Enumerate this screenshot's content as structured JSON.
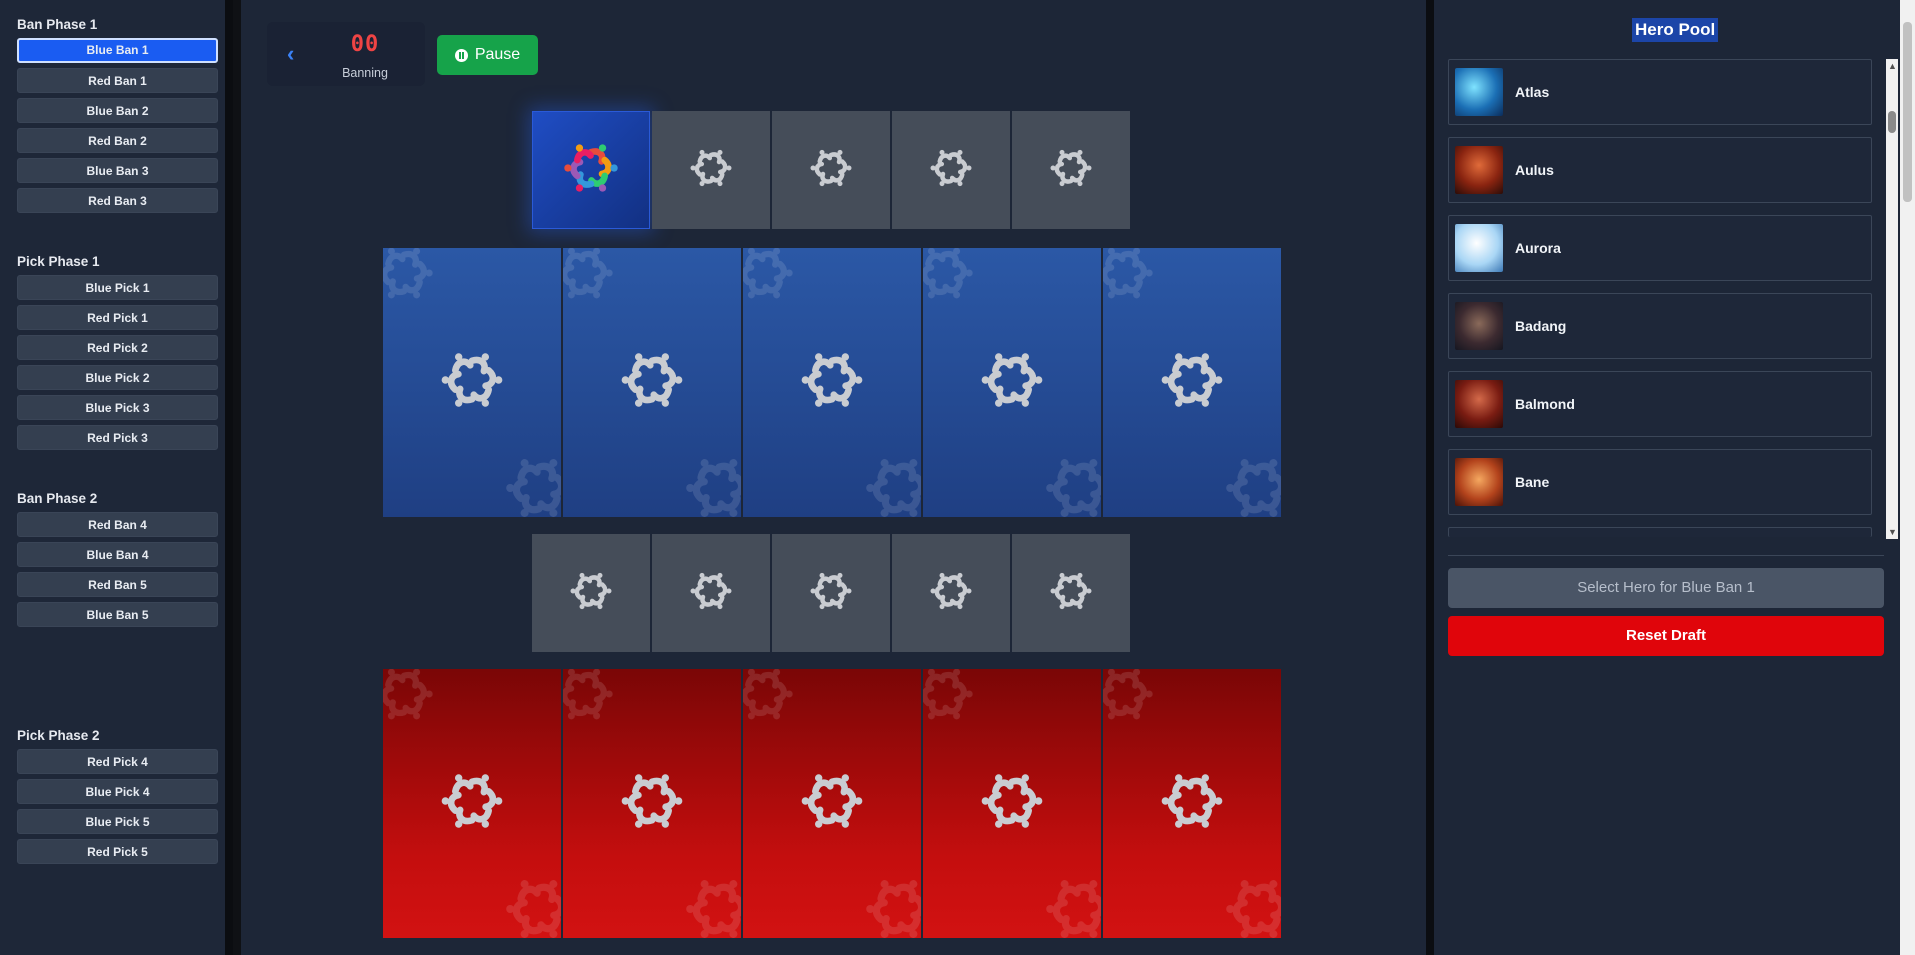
{
  "left_panel": {
    "phases": [
      {
        "title": "Ban Phase 1",
        "steps": [
          "Blue Ban 1",
          "Red Ban 1",
          "Blue Ban 2",
          "Red Ban 2",
          "Blue Ban 3",
          "Red Ban 3"
        ]
      },
      {
        "title": "Pick Phase 1",
        "steps": [
          "Blue Pick 1",
          "Red Pick 1",
          "Red Pick 2",
          "Blue Pick 2",
          "Blue Pick 3",
          "Red Pick 3"
        ]
      },
      {
        "title": "Ban Phase 2",
        "steps": [
          "Red Ban 4",
          "Blue Ban 4",
          "Red Ban 5",
          "Blue Ban 5"
        ]
      },
      {
        "title": "Pick Phase 2",
        "steps": [
          "Red Pick 4",
          "Blue Pick 4",
          "Blue Pick 5",
          "Red Pick 5"
        ]
      }
    ],
    "active_step": "Blue Ban 1"
  },
  "header": {
    "back_icon": "chevron-left-icon",
    "timer": "00",
    "status": "Banning",
    "pause_label": "Pause",
    "pause_icon": "pause-circle-icon"
  },
  "board": {
    "blue_bans": 5,
    "red_bans": 5,
    "blue_picks": 5,
    "red_picks": 5,
    "active_ban_slot": 1,
    "placeholder_icon": "mlbb-logo-icon"
  },
  "hero_pool": {
    "title": "Hero Pool",
    "heroes": [
      "Atlas",
      "Aulus",
      "Aurora",
      "Badang",
      "Balmond",
      "Bane"
    ],
    "select_label": "Select Hero for Blue Ban 1",
    "reset_label": "Reset Draft"
  },
  "colors": {
    "accent_blue": "#1a5cf2",
    "blue_team": "#2b58a6",
    "red_team": "#c40e0e",
    "pause_green": "#16a34a",
    "reset_red": "#e0050b",
    "timer_red": "#ef4444"
  }
}
